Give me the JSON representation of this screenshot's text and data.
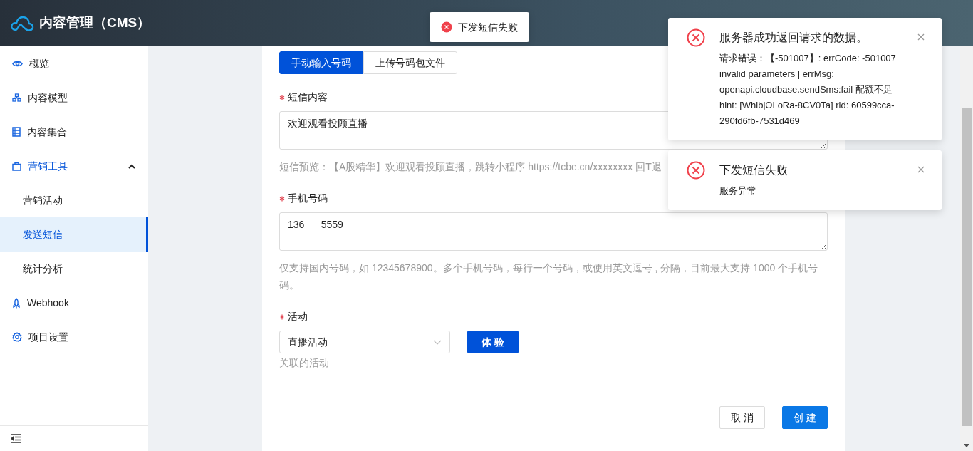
{
  "header": {
    "title": "内容管理（CMS）"
  },
  "sidebar": {
    "items": [
      {
        "label": "概览",
        "selected": false
      },
      {
        "label": "内容模型",
        "selected": false
      },
      {
        "label": "内容集合",
        "selected": false
      },
      {
        "label": "营销工具",
        "selected": false,
        "expanded": true,
        "children": [
          {
            "label": "营销活动",
            "selected": false
          },
          {
            "label": "发送短信",
            "selected": true
          },
          {
            "label": "统计分析",
            "selected": false
          }
        ]
      },
      {
        "label": "Webhook",
        "selected": false
      },
      {
        "label": "项目设置",
        "selected": false
      }
    ]
  },
  "tabs": [
    {
      "label": "手动输入号码",
      "selected": true
    },
    {
      "label": "上传号码包文件",
      "selected": false
    }
  ],
  "fields": [
    {
      "kind": "textarea",
      "required": true,
      "label": "短信内容",
      "value": "欢迎观看投顾直播",
      "hint": "短信预览：【A股精华】欢迎观看投顾直播，跳转小程序 https://tcbe.cn/xxxxxxxx 回T退"
    },
    {
      "kind": "textarea",
      "required": true,
      "label": "手机号码",
      "value": "136      5559",
      "hint": "仅支持国内号码，如 12345678900。多个手机号码，每行一个号码，或使用英文逗号 , 分隔，目前最大支持 1000 个手机号码。"
    },
    {
      "kind": "select",
      "required": true,
      "label": "活动",
      "value": "直播活动",
      "button": "体 验",
      "hint": "关联的活动"
    }
  ],
  "actions": [
    {
      "label": "取 消",
      "primary": false
    },
    {
      "label": "创 建",
      "primary": true
    }
  ],
  "message": {
    "kind": "error",
    "text": "下发短信失败"
  },
  "notifications": [
    {
      "kind": "error",
      "title": "服务器成功返回请求的数据。",
      "description": "请求错误：【-501007】: errCode: -501007 invalid parameters | errMsg: openapi.cloudbase.sendSms:fail 配额不足 hint: [WhlbjOLoRa-8CV0Ta] rid: 60599cca-290fd6fb-7531d469"
    },
    {
      "kind": "error",
      "title": "下发短信失败",
      "description": "服务异常"
    }
  ]
}
